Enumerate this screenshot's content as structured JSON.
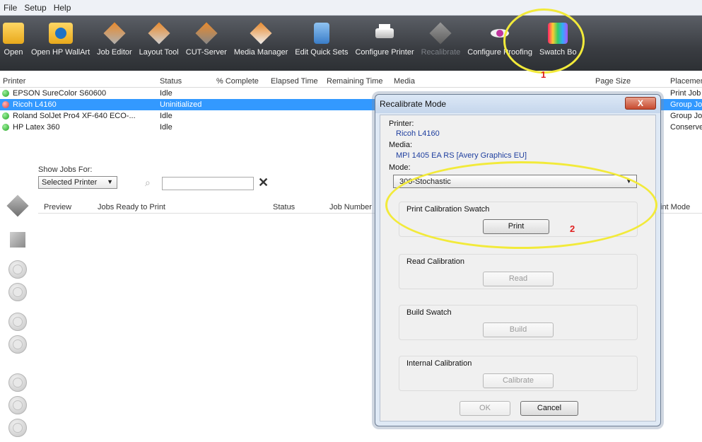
{
  "menu": [
    "File",
    "Setup",
    "Help"
  ],
  "toolbar": [
    {
      "label": "Open",
      "icon": "folder-icon",
      "disabled": false
    },
    {
      "label": "Open HP WallArt",
      "icon": "hp-wallart-icon",
      "disabled": false
    },
    {
      "label": "Job Editor",
      "icon": "job-editor-icon",
      "disabled": false
    },
    {
      "label": "Layout Tool",
      "icon": "layout-tool-icon",
      "disabled": false
    },
    {
      "label": "CUT-Server",
      "icon": "cut-server-icon",
      "disabled": false
    },
    {
      "label": "Media Manager",
      "icon": "media-manager-icon",
      "disabled": false
    },
    {
      "label": "Edit Quick Sets",
      "icon": "quick-sets-icon",
      "disabled": false
    },
    {
      "label": "Configure Printer",
      "icon": "printer-icon",
      "disabled": false
    },
    {
      "label": "Recalibrate",
      "icon": "recalibrate-icon",
      "disabled": true
    },
    {
      "label": "Configure Proofing",
      "icon": "eye-icon",
      "disabled": false
    },
    {
      "label": "Swatch Bo",
      "icon": "swatch-book-icon",
      "disabled": false
    }
  ],
  "printers": {
    "headers": [
      "Printer",
      "Status",
      "% Complete",
      "Elapsed Time",
      "Remaining Time",
      "Media",
      "Page Size",
      "Placemen"
    ],
    "rows": [
      {
        "name": "EPSON SureColor S60600",
        "status": "Idle",
        "placement": "Print Job",
        "state": "ready",
        "selected": false
      },
      {
        "name": "Ricoh L4160",
        "status": "Uninitialized",
        "placement": "Group Jo",
        "state": "error",
        "selected": true
      },
      {
        "name": "Roland SolJet Pro4 XF-640 ECO-...",
        "status": "Idle",
        "placement": "Group Jo",
        "state": "ready",
        "selected": false
      },
      {
        "name": "HP Latex 360",
        "status": "Idle",
        "placement": "Conserve",
        "state": "ready",
        "selected": false
      }
    ]
  },
  "jobs": {
    "show_for_label": "Show Jobs For:",
    "show_for_value": "Selected Printer",
    "search_placeholder": "",
    "headers": [
      "Preview",
      "Jobs Ready to Print",
      "Status",
      "Job Number",
      "int Mode"
    ]
  },
  "dialog": {
    "title": "Recalibrate Mode",
    "printer_label": "Printer:",
    "printer_value": "Ricoh L4160",
    "media_label": "Media:",
    "media_value": "MPI 1405 EA RS [Avery Graphics EU]",
    "mode_label": "Mode:",
    "mode_value": "300-Stochastic",
    "groups": [
      {
        "label": "Print Calibration Swatch",
        "button": "Print",
        "enabled": true
      },
      {
        "label": "Read Calibration",
        "button": "Read",
        "enabled": false
      },
      {
        "label": "Build Swatch",
        "button": "Build",
        "enabled": false
      },
      {
        "label": "Internal Calibration",
        "button": "Calibrate",
        "enabled": false
      }
    ],
    "ok_label": "OK",
    "cancel_label": "Cancel",
    "close_label": "X"
  },
  "annotations": {
    "step1": "1",
    "step2": "2",
    "color": "#f2ea3a"
  }
}
